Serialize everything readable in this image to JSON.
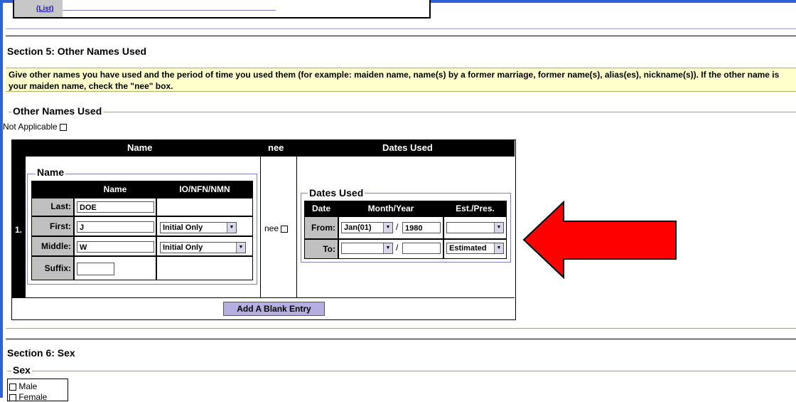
{
  "prev_section": {
    "link_label": "(List)"
  },
  "section5": {
    "title": "Section 5: Other Names Used",
    "instructions": "Give other names you have used and the period of time you used them (for example: maiden name, name(s) by a former marriage, former name(s), alias(es), nickname(s)). If the other name is your maiden name, check the \"nee\" box.",
    "group_title": "Other Names Used",
    "not_applicable_label": "Not Applicable",
    "table_headers": {
      "num": "#",
      "name": "Name",
      "nee": "nee",
      "dates": "Dates Used"
    },
    "entry": {
      "number": "1.",
      "name_group_title": "Name",
      "name_headers": {
        "name": "Name",
        "io": "IO/NFN/NMN"
      },
      "rows": [
        {
          "label": "Last:",
          "value": "DOE",
          "io": ""
        },
        {
          "label": "First:",
          "value": "J",
          "io": "Initial Only"
        },
        {
          "label": "Middle:",
          "value": "W",
          "io": "Initial Only"
        },
        {
          "label": "Suffix:",
          "value": "",
          "io": ""
        }
      ],
      "nee_label": "nee",
      "dates_group_title": "Dates Used",
      "dates_headers": {
        "date": "Date",
        "month_year": "Month/Year",
        "est": "Est./Pres."
      },
      "from": {
        "label": "From:",
        "month": "Jan(01)",
        "sep": "/",
        "year": "1980",
        "est": ""
      },
      "to": {
        "label": "To:",
        "month": "",
        "sep": "/",
        "year": "",
        "est": "Estimated"
      }
    },
    "add_button": "Add A Blank Entry"
  },
  "section6": {
    "title": "Section 6: Sex",
    "group_title": "Sex",
    "options": [
      "Male",
      "Female"
    ]
  },
  "colors": {
    "frame": "#2e62d4",
    "instructions_bg": "#ffffcc",
    "button_bg": "#b5aee0",
    "arrow": "#ff0000"
  }
}
